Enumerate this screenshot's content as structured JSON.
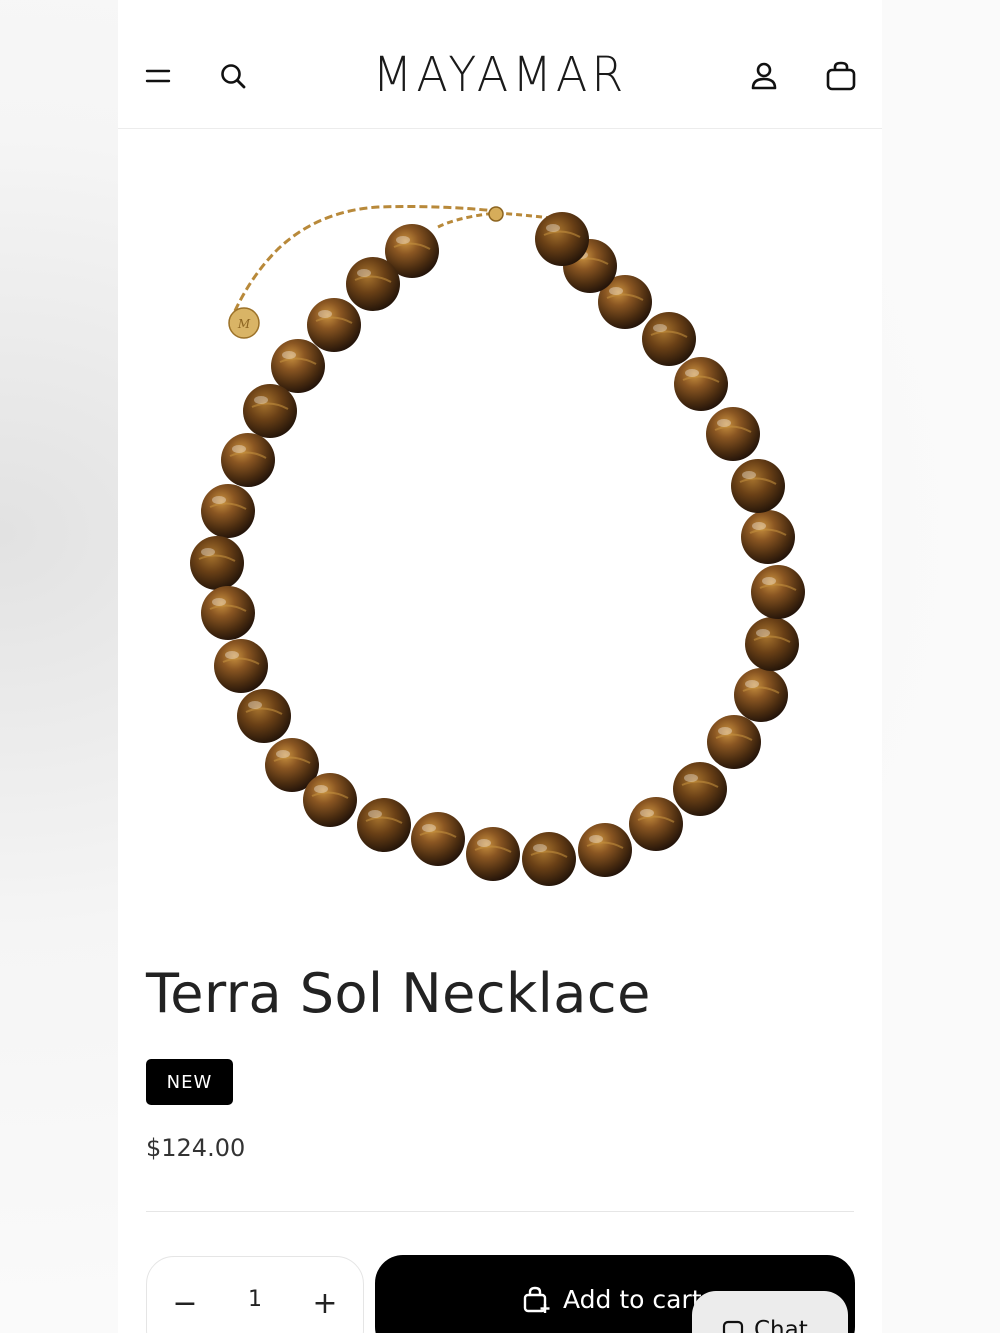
{
  "header": {
    "logo": "MAYAMAR",
    "icons": [
      "menu-icon",
      "search-icon",
      "account-icon",
      "cart-icon"
    ]
  },
  "product": {
    "title": "Terra Sol Necklace",
    "badge": "NEW",
    "price": "$124.00"
  },
  "purchase": {
    "quantity": "1",
    "minus_label": "−",
    "plus_label": "+",
    "add_to_cart_label": "Add to cart"
  },
  "chat": {
    "label": "Chat"
  },
  "colors": {
    "bead_dark": "#3b240f",
    "bead_mid": "#7a4b1c",
    "bead_light": "#b07a34",
    "chain_gold": "#b88a3a",
    "button_black": "#000000"
  }
}
